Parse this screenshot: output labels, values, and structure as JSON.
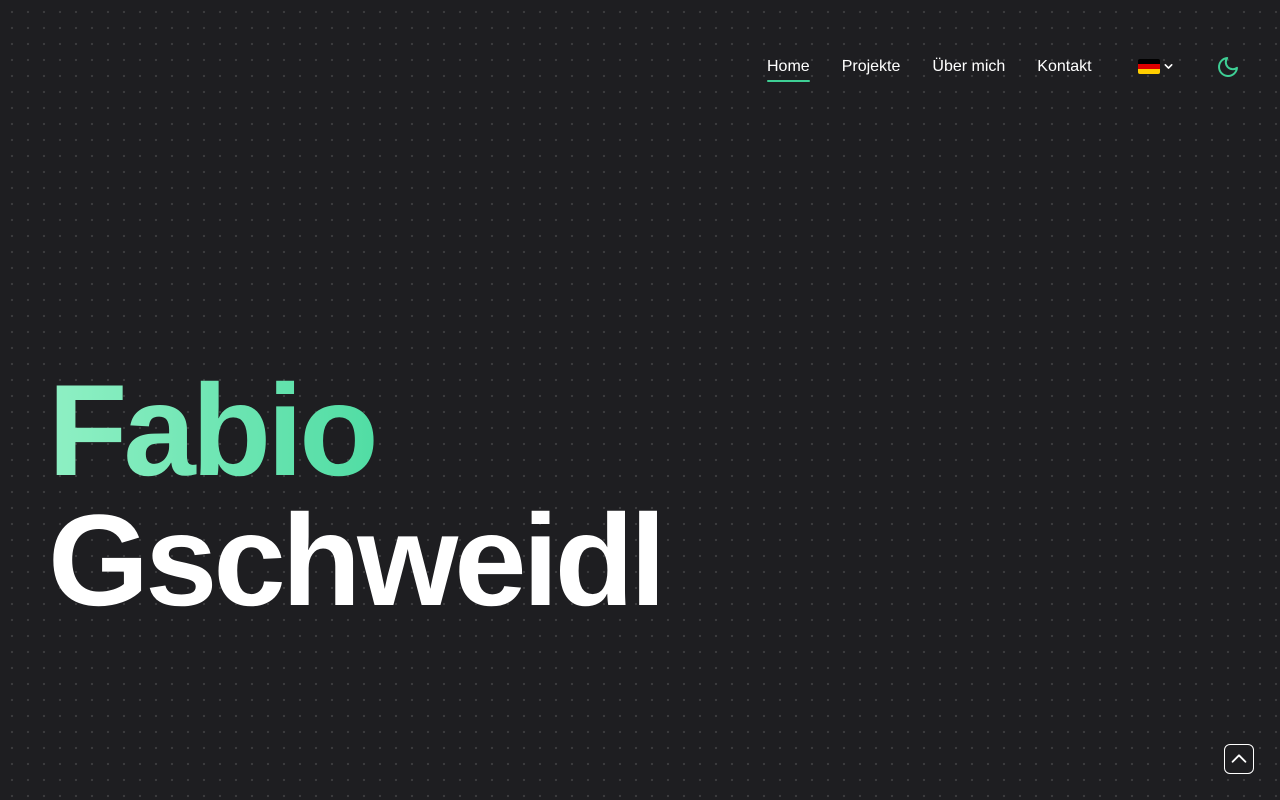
{
  "nav": {
    "items": [
      {
        "label": "Home",
        "active": true
      },
      {
        "label": "Projekte",
        "active": false
      },
      {
        "label": "Über mich",
        "active": false
      },
      {
        "label": "Kontakt",
        "active": false
      }
    ],
    "language": {
      "icon": "german-flag-icon",
      "dropdown_icon": "chevron-down-icon"
    },
    "theme_toggle": {
      "icon": "moon-icon"
    }
  },
  "hero": {
    "first_name": "Fabio",
    "last_name": "Gschweidl"
  },
  "scroll_top": {
    "icon": "chevron-up-icon"
  },
  "colors": {
    "background": "#1e1e21",
    "accent": "#3ecf95",
    "accent_light": "#8ff0c4",
    "text": "#ffffff"
  }
}
